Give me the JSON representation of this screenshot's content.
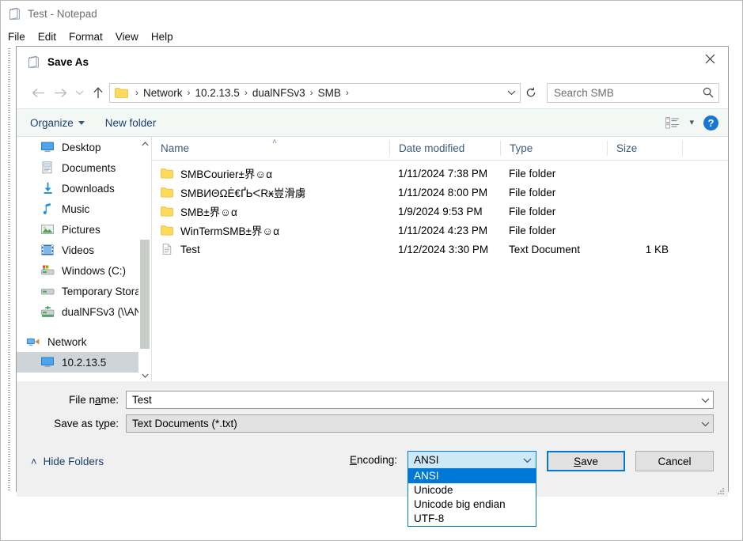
{
  "notepad": {
    "title": "Test - Notepad",
    "icon": "notepad-icon",
    "menu": [
      "File",
      "Edit",
      "Format",
      "View",
      "Help"
    ]
  },
  "dialog": {
    "title": "Save As",
    "icon": "notepad-icon",
    "close_label": "✕",
    "nav": {
      "back": "←",
      "forward": "→",
      "recent": "∨",
      "up": "↑",
      "refresh": "⟳",
      "address_dropdown": "∨"
    },
    "breadcrumb": {
      "folder_icon": "folder-icon",
      "items": [
        "Network",
        "10.2.13.5",
        "dualNFSv3",
        "SMB"
      ],
      "separator": "›",
      "trailing_separator": "›"
    },
    "search": {
      "placeholder": "Search SMB",
      "icon": "search-icon"
    },
    "commandbar": {
      "organize": "Organize",
      "new_folder": "New folder",
      "view_icon": "view-layout-icon",
      "view_caret": "▾",
      "help": "?"
    },
    "tree": {
      "items": [
        {
          "label": "Desktop",
          "icon": "desktop-icon",
          "selected": false,
          "indent": true
        },
        {
          "label": "Documents",
          "icon": "documents-icon",
          "selected": false,
          "indent": true
        },
        {
          "label": "Downloads",
          "icon": "downloads-icon",
          "selected": false,
          "indent": true
        },
        {
          "label": "Music",
          "icon": "music-icon",
          "selected": false,
          "indent": true
        },
        {
          "label": "Pictures",
          "icon": "pictures-icon",
          "selected": false,
          "indent": true
        },
        {
          "label": "Videos",
          "icon": "videos-icon",
          "selected": false,
          "indent": true
        },
        {
          "label": "Windows (C:)",
          "icon": "drive-icon",
          "selected": false,
          "indent": true
        },
        {
          "label": "Temporary Stora",
          "icon": "drive-icon",
          "selected": false,
          "indent": true
        },
        {
          "label": "dualNFSv3 (\\\\AN",
          "icon": "network-drive-icon",
          "selected": false,
          "indent": true
        },
        {
          "label": "Network",
          "icon": "network-icon",
          "selected": false,
          "indent": false
        },
        {
          "label": "10.2.13.5",
          "icon": "computer-icon",
          "selected": true,
          "indent": true
        }
      ],
      "scroll_up": "˄",
      "scroll_down": "˅"
    },
    "filelist": {
      "columns": [
        "Name",
        "Date modified",
        "Type",
        "Size"
      ],
      "sort_indicator": "˄",
      "rows": [
        {
          "icon": "folder-icon",
          "name": "SMBCourier±界☺α",
          "date": "1/11/2024 7:38 PM",
          "type": "File folder",
          "size": ""
        },
        {
          "icon": "folder-icon",
          "name": "SMBИΘΩĖ€ҐЬᐸRӿ豈滑虜",
          "date": "1/11/2024 8:00 PM",
          "type": "File folder",
          "size": ""
        },
        {
          "icon": "folder-icon",
          "name": "SMB±界☺α",
          "date": "1/9/2024 9:53 PM",
          "type": "File folder",
          "size": ""
        },
        {
          "icon": "folder-icon",
          "name": "WinTermSMB±界☺α",
          "date": "1/11/2024 4:23 PM",
          "type": "File folder",
          "size": ""
        },
        {
          "icon": "text-document-icon",
          "name": "Test",
          "date": "1/12/2024 3:30 PM",
          "type": "Text Document",
          "size": "1 KB"
        }
      ]
    },
    "form": {
      "filename_label": "File name:",
      "filename_value": "Test",
      "savetype_label": "Save as type:",
      "savetype_value": "Text Documents (*.txt)",
      "chevron": "∨"
    },
    "footer": {
      "hide_folders": "Hide Folders",
      "hide_folders_caret": "˄",
      "encoding_label": "Encoding:",
      "encoding_value": "ANSI",
      "encoding_chevron": "∨",
      "encoding_options": [
        "ANSI",
        "Unicode",
        "Unicode big endian",
        "UTF-8"
      ],
      "encoding_selected_index": 0,
      "save_button": "Save",
      "cancel_button": "Cancel"
    }
  },
  "colors": {
    "accent": "#0078d7",
    "combo_fill": "#cde8f7",
    "selection": "#cfd4d8",
    "link_text": "#1b3f6e",
    "command_bar": "#f3f8f5",
    "dialog_bg": "#f0f0f0",
    "folder_yellow": "#ffd95a"
  }
}
